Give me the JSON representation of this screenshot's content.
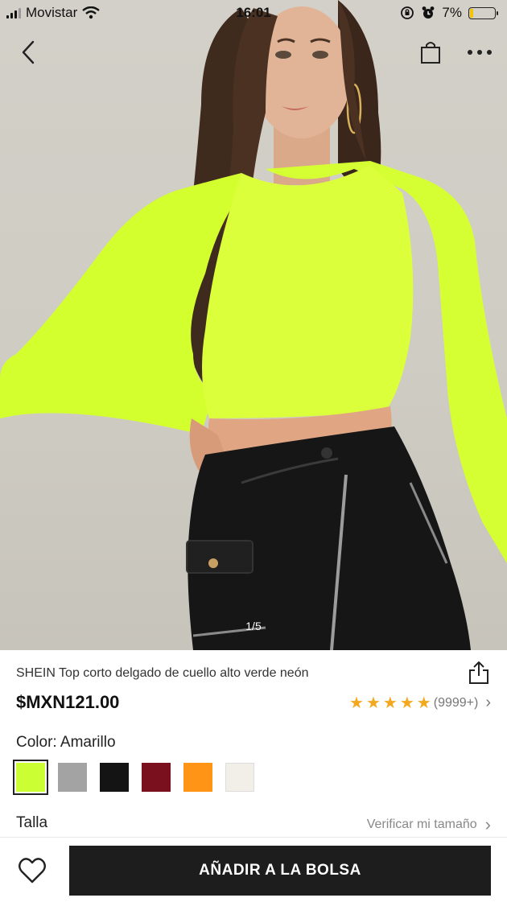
{
  "status_bar": {
    "carrier": "Movistar",
    "time": "16:01",
    "battery": "7%"
  },
  "gallery": {
    "pager": "1/5"
  },
  "product": {
    "title": "SHEIN Top corto delgado de cuello alto verde neón",
    "price": "$MXN121.00",
    "rating_count": "(9999+)",
    "stars": 5,
    "color_label": "Color: Amarillo",
    "colors": [
      "#ccff33",
      "#a3a3a3",
      "#141414",
      "#7a0f1e",
      "#ff9416",
      "#f2efe9"
    ],
    "size_label": "Talla",
    "size_check": "Verificar mi tamaño"
  },
  "actions": {
    "add_to_bag": "AÑADIR A LA BOLSA"
  },
  "icons": {
    "back": "chevron-left-icon",
    "bag": "shopping-bag-icon",
    "more": "more-icon",
    "share": "share-icon",
    "favorite": "heart-icon"
  }
}
